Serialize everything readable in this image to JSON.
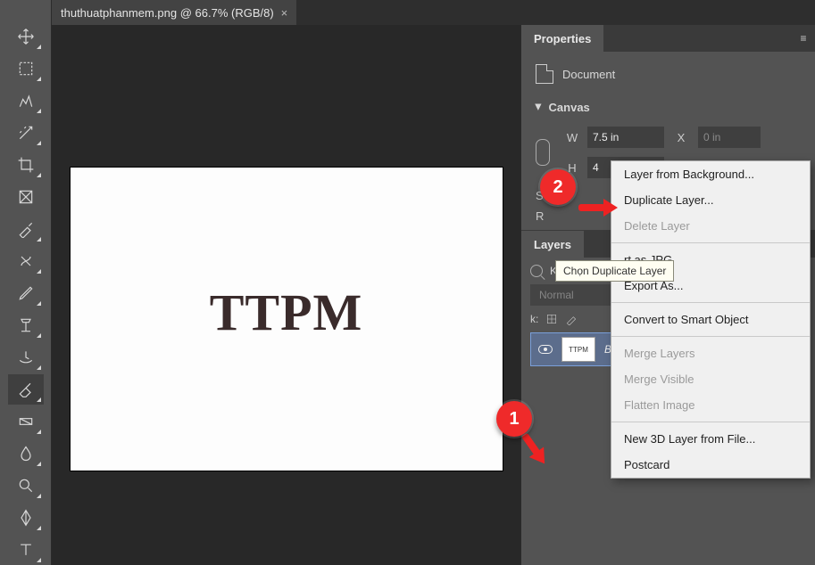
{
  "tab": {
    "title": "thuthuatphanmem.png @ 66.7% (RGB/8)"
  },
  "canvas_art": "TTPM",
  "toolbar": {
    "tools": [
      "move-tool",
      "marquee-tool",
      "lasso-tool",
      "magic-wand-tool",
      "crop-tool",
      "frame-tool",
      "eyedropper-tool",
      "healing-brush-tool",
      "pencil-tool",
      "clone-stamp-tool",
      "history-brush-tool",
      "eraser-tool",
      "gradient-tool",
      "blur-tool",
      "dodge-tool",
      "pen-tool",
      "type-tool"
    ]
  },
  "properties": {
    "title": "Properties",
    "doc_label": "Document",
    "canvas_section": "Canvas",
    "w_label": "W",
    "w_value": "7.5 in",
    "x_label": "X",
    "x_value": "0 in",
    "h_label": "H",
    "h_value": "4",
    "partial_mode_s": "S",
    "partial_res": "R"
  },
  "layers": {
    "title": "Layers",
    "kind_label": "Kind",
    "blend_mode": "Normal",
    "lock_label": "k:",
    "bg_name": "Background",
    "thumb_text": "TTPM"
  },
  "context_menu": {
    "items": [
      {
        "label": "Layer from Background...",
        "enabled": true
      },
      {
        "label": "Duplicate Layer...",
        "enabled": true
      },
      {
        "label": "Delete Layer",
        "enabled": false
      },
      {
        "sep": true
      },
      {
        "label": "rt as JPG",
        "enabled": true,
        "prefix_cut": true
      },
      {
        "label": "Export As...",
        "enabled": true,
        "prefix_cut2": true
      },
      {
        "sep": true
      },
      {
        "label": "Convert to Smart Object",
        "enabled": true
      },
      {
        "sep": true
      },
      {
        "label": "Merge Layers",
        "enabled": false
      },
      {
        "label": "Merge Visible",
        "enabled": false
      },
      {
        "label": "Flatten Image",
        "enabled": false
      },
      {
        "sep": true
      },
      {
        "label": "New 3D Layer from File...",
        "enabled": true
      },
      {
        "label": "Postcard",
        "enabled": true
      }
    ]
  },
  "tooltip": "Chọn Duplicate Layer",
  "annotations": {
    "one": "1",
    "two": "2"
  }
}
